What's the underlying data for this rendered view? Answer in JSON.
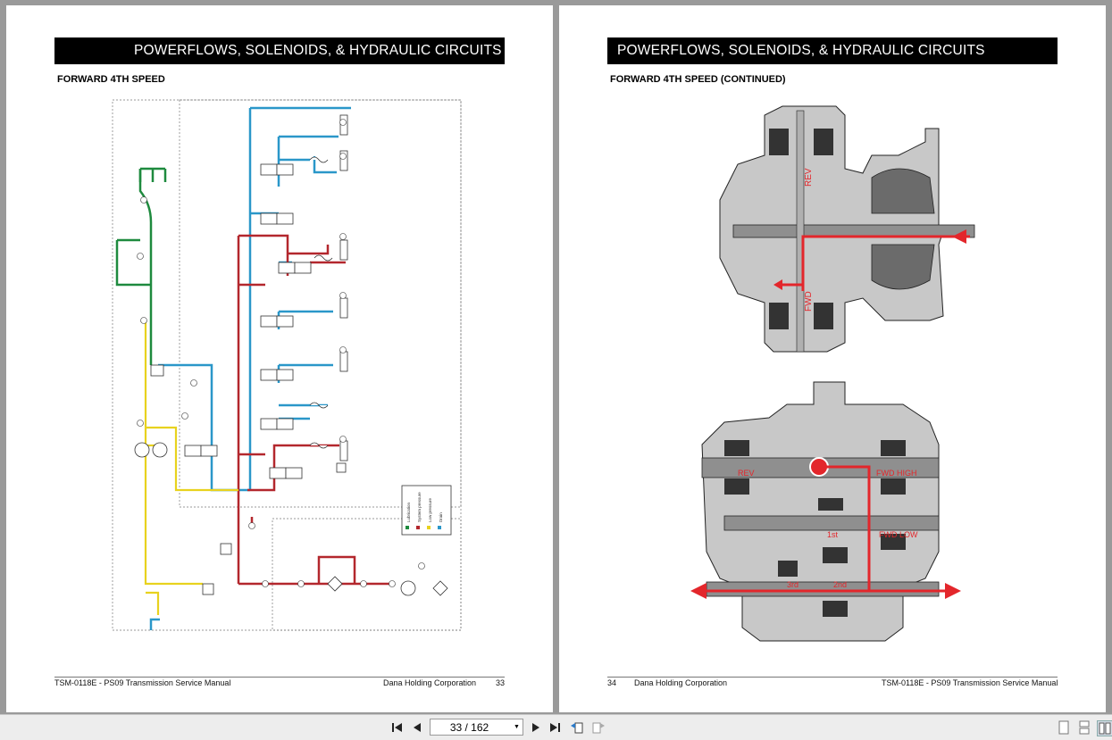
{
  "left_page": {
    "banner": "POWERFLOWS, SOLENOIDS, & HYDRAULIC CIRCUITS",
    "subheading": "FORWARD 4TH SPEED",
    "footer_left": "TSM-0118E - PS09 Transmission Service Manual",
    "footer_company": "Dana Holding Corporation",
    "footer_page": "33",
    "legend": [
      "Lubrication",
      "System pressure",
      "Low pressure",
      "Drain"
    ]
  },
  "right_page": {
    "banner": "POWERFLOWS, SOLENOIDS, & HYDRAULIC CIRCUITS",
    "subheading": "FORWARD 4TH SPEED (CONTINUED)",
    "footer_page": "34",
    "footer_company": "Dana Holding Corporation",
    "footer_right": "TSM-0118E - PS09 Transmission Service Manual",
    "labels_top": [
      "REV",
      "FWD"
    ],
    "labels_bottom": [
      "REV",
      "FWD HIGH",
      "1st",
      "FWD LOW",
      "3rd",
      "2nd"
    ]
  },
  "toolbar": {
    "page_indicator": "33 / 162"
  },
  "colors": {
    "lubrication": "#1e8a3e",
    "system_pressure": "#b3272d",
    "low_pressure": "#e8d21e",
    "drain": "#2a97c9",
    "powerflow": "#e3262b"
  }
}
